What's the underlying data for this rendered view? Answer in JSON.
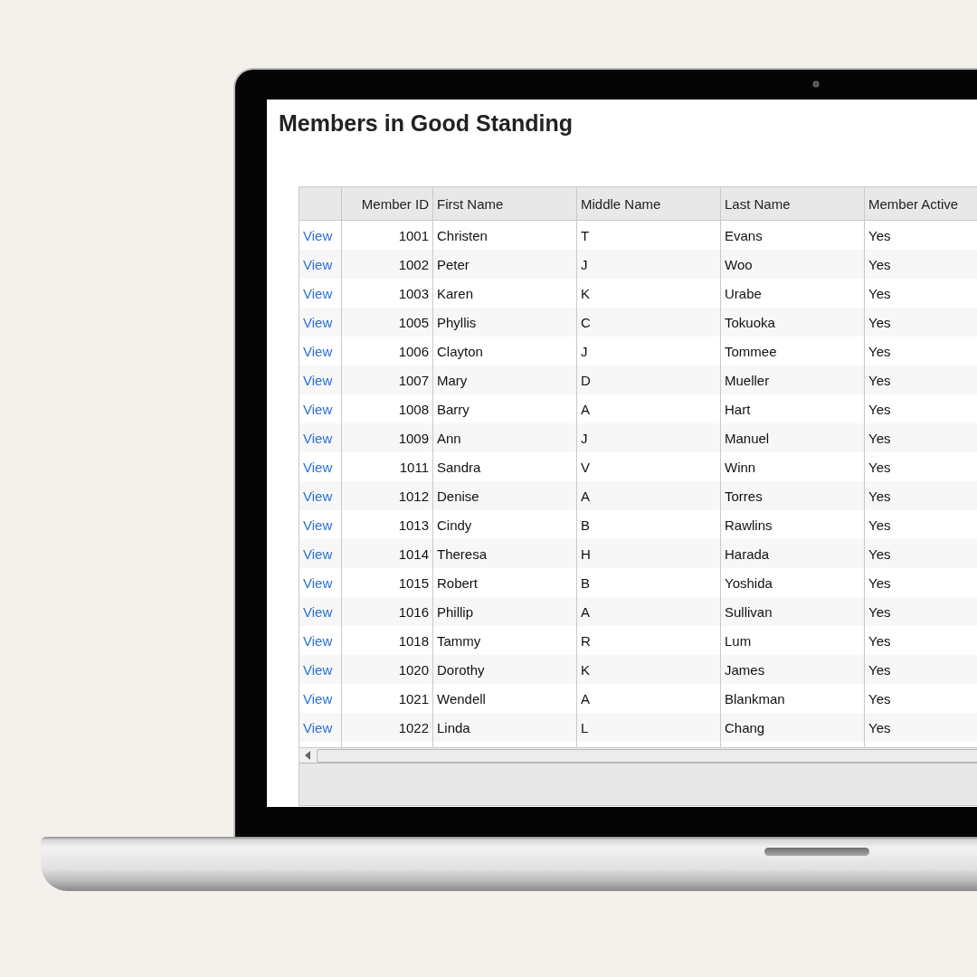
{
  "page": {
    "title": "Members in Good Standing"
  },
  "table": {
    "columns": [
      "Member ID",
      "First Name",
      "Middle Name",
      "Last Name",
      "Member Active"
    ],
    "rows": [
      {
        "link": "View",
        "member_id": "1001",
        "first_name": "Christen",
        "middle_name": "T",
        "last_name": "Evans",
        "member_active": "Yes"
      },
      {
        "link": "View",
        "member_id": "1002",
        "first_name": "Peter",
        "middle_name": "J",
        "last_name": "Woo",
        "member_active": "Yes"
      },
      {
        "link": "View",
        "member_id": "1003",
        "first_name": "Karen",
        "middle_name": "K",
        "last_name": "Urabe",
        "member_active": "Yes"
      },
      {
        "link": "View",
        "member_id": "1005",
        "first_name": "Phyllis",
        "middle_name": "C",
        "last_name": "Tokuoka",
        "member_active": "Yes"
      },
      {
        "link": "View",
        "member_id": "1006",
        "first_name": "Clayton",
        "middle_name": "J",
        "last_name": "Tommee",
        "member_active": "Yes"
      },
      {
        "link": "View",
        "member_id": "1007",
        "first_name": "Mary",
        "middle_name": "D",
        "last_name": "Mueller",
        "member_active": "Yes"
      },
      {
        "link": "View",
        "member_id": "1008",
        "first_name": "Barry",
        "middle_name": "A",
        "last_name": "Hart",
        "member_active": "Yes"
      },
      {
        "link": "View",
        "member_id": "1009",
        "first_name": "Ann",
        "middle_name": "J",
        "last_name": "Manuel",
        "member_active": "Yes"
      },
      {
        "link": "View",
        "member_id": "1011",
        "first_name": "Sandra",
        "middle_name": "V",
        "last_name": "Winn",
        "member_active": "Yes"
      },
      {
        "link": "View",
        "member_id": "1012",
        "first_name": "Denise",
        "middle_name": "A",
        "last_name": "Torres",
        "member_active": "Yes"
      },
      {
        "link": "View",
        "member_id": "1013",
        "first_name": "Cindy",
        "middle_name": "B",
        "last_name": "Rawlins",
        "member_active": "Yes"
      },
      {
        "link": "View",
        "member_id": "1014",
        "first_name": "Theresa",
        "middle_name": "H",
        "last_name": "Harada",
        "member_active": "Yes"
      },
      {
        "link": "View",
        "member_id": "1015",
        "first_name": "Robert",
        "middle_name": "B",
        "last_name": "Yoshida",
        "member_active": "Yes"
      },
      {
        "link": "View",
        "member_id": "1016",
        "first_name": "Phillip",
        "middle_name": "A",
        "last_name": "Sullivan",
        "member_active": "Yes"
      },
      {
        "link": "View",
        "member_id": "1018",
        "first_name": "Tammy",
        "middle_name": "R",
        "last_name": "Lum",
        "member_active": "Yes"
      },
      {
        "link": "View",
        "member_id": "1020",
        "first_name": "Dorothy",
        "middle_name": "K",
        "last_name": "James",
        "member_active": "Yes"
      },
      {
        "link": "View",
        "member_id": "1021",
        "first_name": "Wendell",
        "middle_name": "A",
        "last_name": "Blankman",
        "member_active": "Yes"
      },
      {
        "link": "View",
        "member_id": "1022",
        "first_name": "Linda",
        "middle_name": "L",
        "last_name": "Chang",
        "member_active": "Yes"
      }
    ]
  }
}
